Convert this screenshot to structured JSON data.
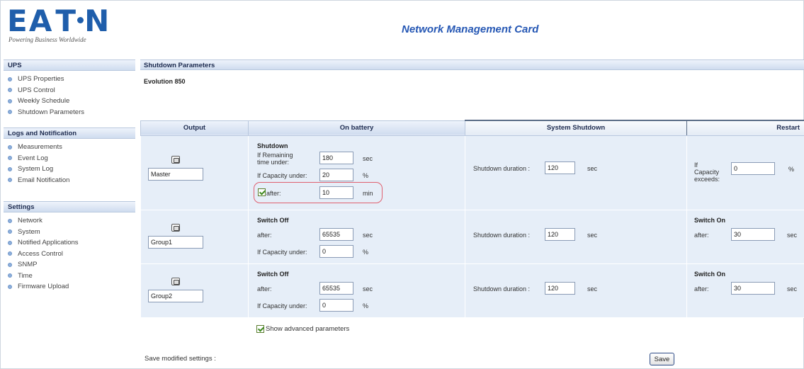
{
  "header": {
    "logo_text": "EATON",
    "tagline": "Powering Business Worldwide",
    "title": "Network Management Card"
  },
  "sidebar": {
    "sections": [
      {
        "title": "UPS",
        "items": [
          "UPS Properties",
          "UPS Control",
          "Weekly Schedule",
          "Shutdown Parameters"
        ]
      },
      {
        "title": "Logs and Notification",
        "items": [
          "Measurements",
          "Event Log",
          "System Log",
          "Email Notification"
        ]
      },
      {
        "title": "Settings",
        "items": [
          "Network",
          "System",
          "Notified Applications",
          "Access Control",
          "SNMP",
          "Time",
          "Firmware Upload"
        ]
      }
    ]
  },
  "main": {
    "section_title": "Shutdown Parameters",
    "model": "Evolution 850",
    "columns": [
      "Output",
      "On battery",
      "System Shutdown",
      "Restart"
    ],
    "rows": [
      {
        "output_name": "Master",
        "battery_title": "Shutdown",
        "remaining_label": "If Remaining time under:",
        "remaining_value": "180",
        "remaining_unit": "sec",
        "capacity_label": "If Capacity under:",
        "capacity_value": "20",
        "capacity_unit": "%",
        "after_label": "after:",
        "after_value": "10",
        "after_unit": "min",
        "shutdown_label": "Shutdown duration :",
        "shutdown_value": "120",
        "shutdown_unit": "sec",
        "restart_label": "If Capacity exceeds:",
        "restart_value": "0",
        "restart_unit": "%"
      },
      {
        "output_name": "Group1",
        "battery_title": "Switch Off",
        "after_label": "after:",
        "after_value": "65535",
        "after_unit": "sec",
        "capacity_label": "If Capacity under:",
        "capacity_value": "0",
        "capacity_unit": "%",
        "shutdown_label": "Shutdown duration :",
        "shutdown_value": "120",
        "shutdown_unit": "sec",
        "restart_title": "Switch On",
        "restart_label": "after:",
        "restart_value": "30",
        "restart_unit": "sec"
      },
      {
        "output_name": "Group2",
        "battery_title": "Switch Off",
        "after_label": "after:",
        "after_value": "65535",
        "after_unit": "sec",
        "capacity_label": "If Capacity under:",
        "capacity_value": "0",
        "capacity_unit": "%",
        "shutdown_label": "Shutdown duration :",
        "shutdown_value": "120",
        "shutdown_unit": "sec",
        "restart_title": "Switch On",
        "restart_label": "after:",
        "restart_value": "30",
        "restart_unit": "sec"
      }
    ],
    "advanced_label": "Show advanced parameters",
    "save_label": "Save modified settings :",
    "save_button": "Save"
  },
  "colors": {
    "brand": "#1f5eab",
    "title": "#2557b4",
    "header_band": "#cfdcef",
    "cell_bg": "#e6eef8",
    "highlight": "#e06070"
  }
}
